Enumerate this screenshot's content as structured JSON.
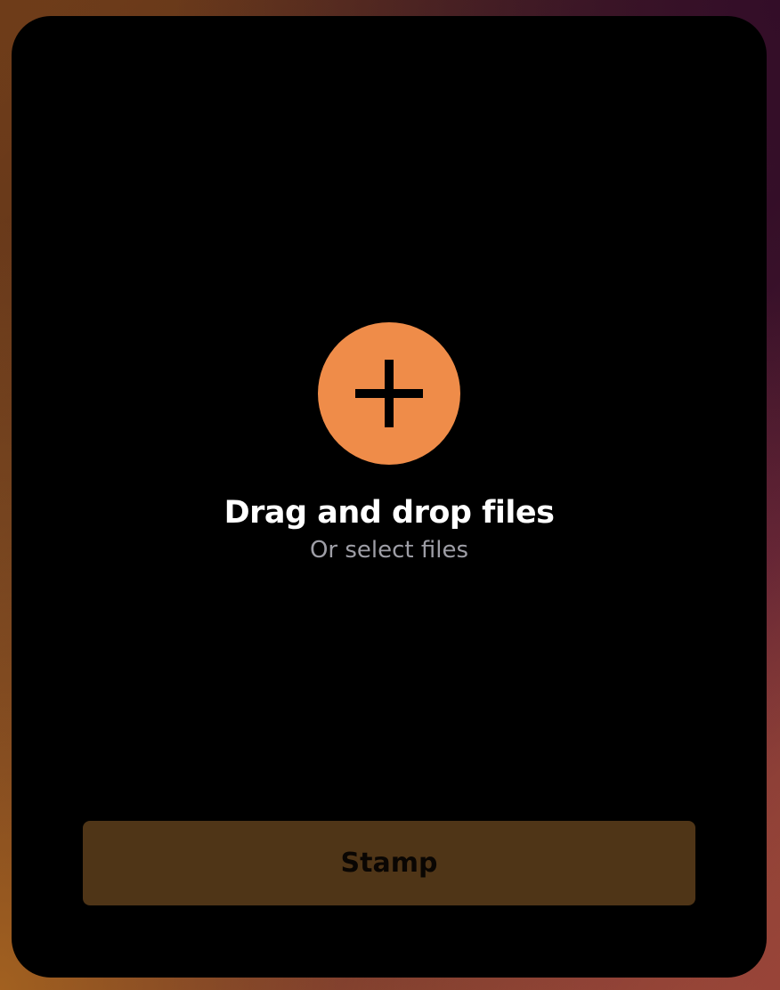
{
  "upload": {
    "icon": "plus-icon",
    "title": "Drag and drop files",
    "subtitle": "Or select files"
  },
  "actions": {
    "stamp_label": "Stamp"
  },
  "colors": {
    "accent": "#ef8c49",
    "card_background": "#000000",
    "button_background": "#4f3517",
    "subtitle_text": "#9e9ea6"
  }
}
